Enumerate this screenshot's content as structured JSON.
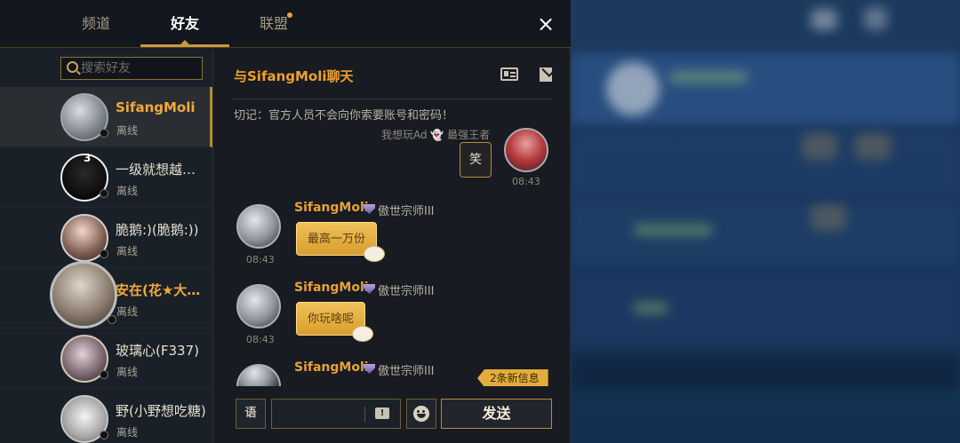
{
  "tabs": [
    {
      "label": "频道"
    },
    {
      "label": "好友"
    },
    {
      "label": "联盟"
    }
  ],
  "close_label": "×",
  "search": {
    "placeholder": "搜索好友"
  },
  "friends": [
    {
      "name": "SifangMoli",
      "status": "离线"
    },
    {
      "name": "一级就想越…",
      "status": "离线",
      "badge": "3"
    },
    {
      "name": "脆鹅:)(脆鹅:))",
      "status": "离线"
    },
    {
      "name": "安在(花★大…",
      "status": "离线"
    },
    {
      "name": "玻璃心(F337)",
      "status": "离线"
    },
    {
      "name": "野(小野想吃糖)",
      "status": "离线"
    }
  ],
  "chat": {
    "title": "与SifangMoli聊天",
    "warning": "切记：官方人员不会向你索要账号和密码！",
    "faded_text": "我想玩Ad 👻 最强王者",
    "messages": [
      {
        "text": "笑",
        "time": "08:43",
        "side": "right"
      },
      {
        "sender": "SifangMoli",
        "rank": "傲世宗师III",
        "text": "最高一万份",
        "time": "08:43"
      },
      {
        "sender": "SifangMoli",
        "rank": "傲世宗师III",
        "text": "你玩啥呢",
        "time": "08:43"
      },
      {
        "sender": "SifangMoli",
        "rank": "傲世宗师III"
      }
    ],
    "new_messages": "2条新信息",
    "voice_label": "语",
    "send_label": "发送"
  },
  "colors": {
    "accent_gold": "#efa12f",
    "bubble_gold": "#e3ad3c",
    "panel_bg": "#181b21"
  }
}
